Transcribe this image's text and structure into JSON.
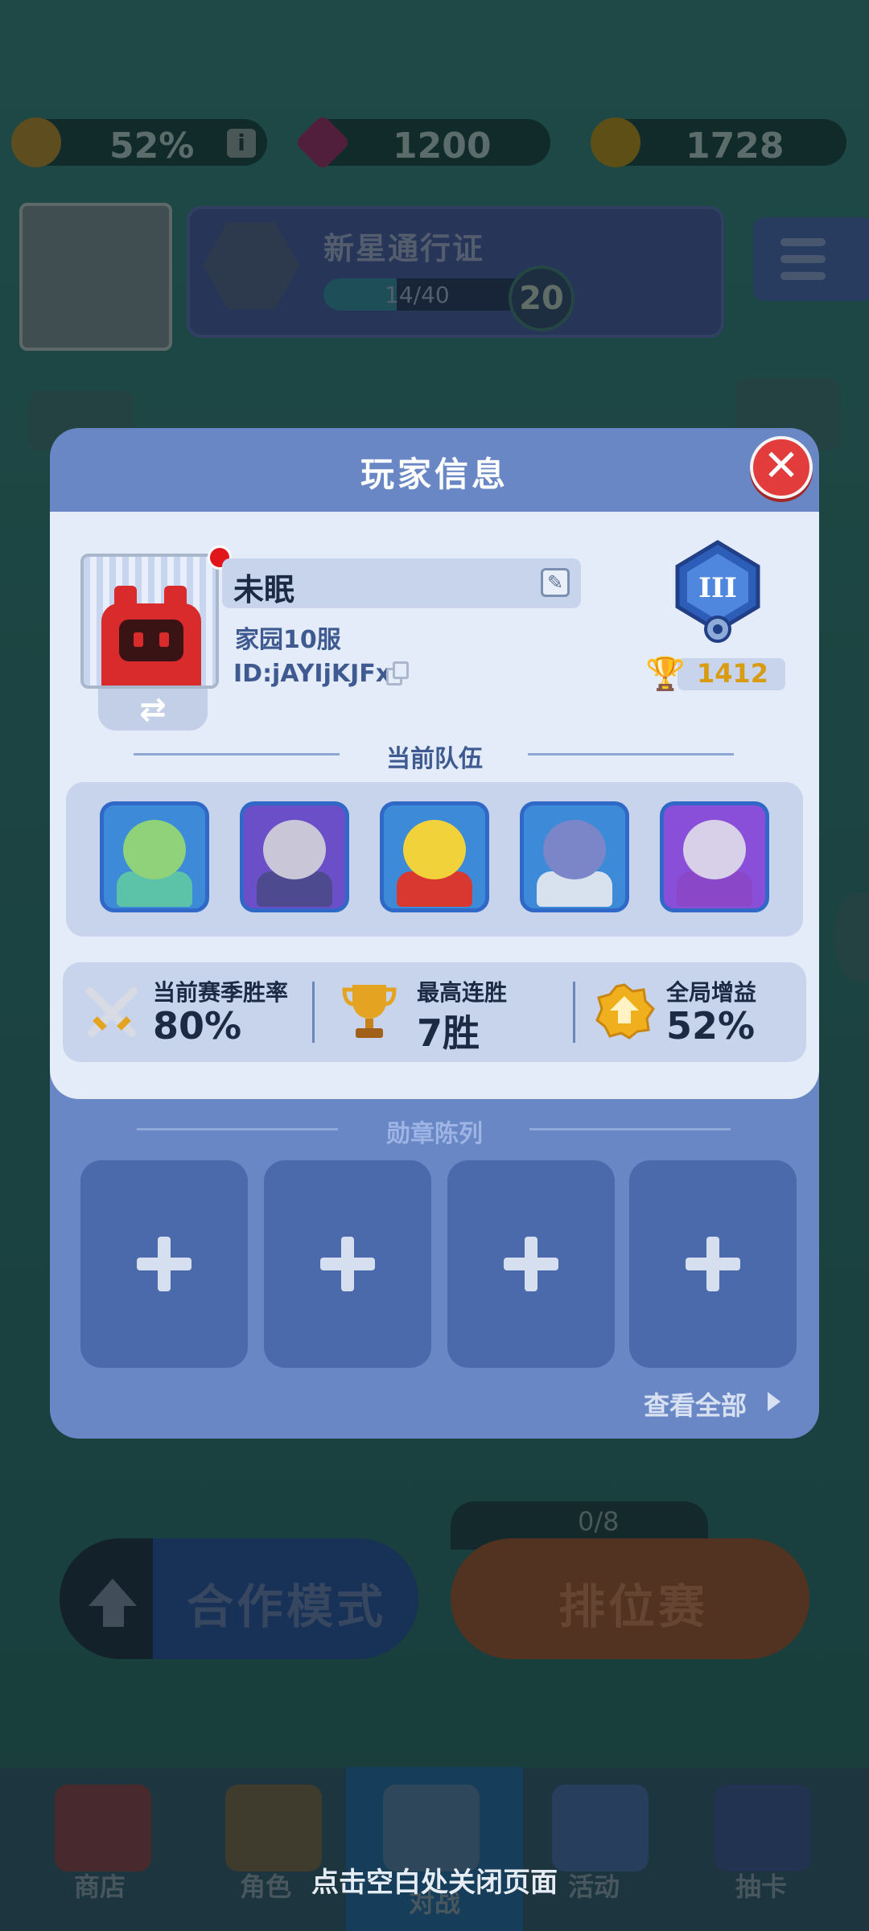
{
  "background": {
    "resources": {
      "buff_percent": "52%",
      "gems": "1200",
      "coins": "1728",
      "info_glyph": "i"
    },
    "pass": {
      "title": "新星通行证",
      "progress_text": "14/40",
      "progress_fraction": 0.35,
      "level": "20"
    },
    "modes": {
      "coop_label": "合作模式",
      "ranked_label": "排位赛",
      "ranked_counter": "0/8"
    },
    "bottom_nav": [
      "商店",
      "角色",
      "对战",
      "活动",
      "抽卡"
    ]
  },
  "modal": {
    "title": "玩家信息",
    "close_glyph": "✕",
    "player": {
      "name": "未眠",
      "server": "家园10服",
      "id": "ID:jAYIjKJFxr",
      "swap_glyph": "⇄",
      "edit_glyph": "✎",
      "rank_numeral": "III",
      "trophies": "1412",
      "trophy_glyph": "🏆"
    },
    "team_title": "当前队伍",
    "team": [
      {
        "name": "hero-1",
        "head": "#8fd27a",
        "body": "#5cc3a8",
        "bg": "#3d8bd8"
      },
      {
        "name": "hero-2",
        "head": "#c9c6d8",
        "body": "#4e4a8f",
        "bg": "#6a4fc9"
      },
      {
        "name": "hero-3",
        "head": "#f2d23a",
        "body": "#d8382f",
        "bg": "#3d8bd8"
      },
      {
        "name": "hero-4",
        "head": "#7a86c8",
        "body": "#d8e2ee",
        "bg": "#3d8bd8"
      },
      {
        "name": "hero-5",
        "head": "#d8cfe8",
        "body": "#8a48c8",
        "bg": "#8a4fd8"
      }
    ],
    "stats": {
      "win_rate_label": "当前赛季胜率",
      "win_rate_value": "80%",
      "streak_label": "最高连胜",
      "streak_value": "7胜",
      "buff_label": "全局增益",
      "buff_value": "52%"
    },
    "medals_title": "勋章陈列",
    "medal_slots": 4,
    "view_all": "查看全部"
  },
  "close_hint": "点击空白处关闭页面",
  "colors": {
    "modal_header": "#6887c4",
    "modal_body": "#e3ecf8",
    "close_button": "#e23c3c",
    "trophy": "#d99b10"
  }
}
